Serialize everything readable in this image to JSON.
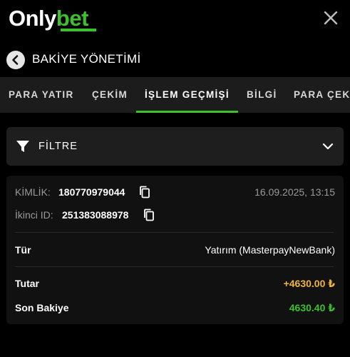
{
  "header": {
    "logo_part1": "Only",
    "logo_part2": "bet",
    "close_icon": "close-icon"
  },
  "subheader": {
    "title": "BAKİYE YÖNETİMİ",
    "back_icon": "chevron-left-icon"
  },
  "tabs": [
    {
      "label": "PARA YATIR",
      "active": false
    },
    {
      "label": "ÇEKİM",
      "active": false
    },
    {
      "label": "İŞLEM GEÇMİŞİ",
      "active": true
    },
    {
      "label": "BİLGİ",
      "active": false
    },
    {
      "label": "PARA ÇEKME",
      "active": false
    }
  ],
  "filter": {
    "label": "FİLTRE",
    "icon": "funnel-icon",
    "toggle_icon": "chevron-down-icon"
  },
  "transaction": {
    "id_label": "KİMLİK:",
    "id_value": "180770979044",
    "date": "16.09.2025, 13:15",
    "second_id_label": "İkinci ID:",
    "second_id_value": "251383088978",
    "type_label": "Tür",
    "type_value": "Yatırım (MasterpayNewBank)",
    "amount_label": "Tutar",
    "amount_value": "+4630.00 ₺",
    "balance_label": "Son Bakiye",
    "balance_value": "4630.40 ₺"
  },
  "colors": {
    "accent": "#3cc02c",
    "amount": "#f0b33b",
    "background": "#000000"
  }
}
